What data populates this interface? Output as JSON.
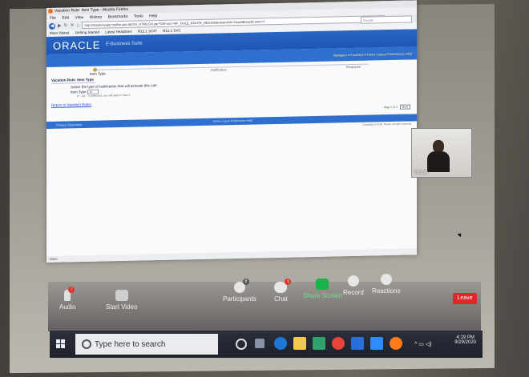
{
  "browser": {
    "title": "Vacation Rule: Item Type - Mozilla Firefox",
    "menu": [
      "File",
      "Edit",
      "View",
      "History",
      "Bookmarks",
      "Tools",
      "Help"
    ],
    "url": "http://ebsdemoapp.myfirst.gov.ab/OA_HTML/OA.jsp?OAFunc=WF_RULE_ROUTE_REGION&retainAM=Y&addBreadCrumb=Y",
    "search_placeholder": "Google",
    "bookmarks": [
      "Most Visited",
      "Getting Started",
      "Latest Headlines",
      "R12.1 SOIT",
      "R12.1 SVC"
    ],
    "status": "Done"
  },
  "app": {
    "logo": "ORACLE",
    "suite": "E-Business Suite",
    "header_links": "Navigator ▾   Favorites ▾   Home  Logout  Preferences  Help",
    "train_step": "Item Type",
    "train_notification": "Notification",
    "train_next": "Response",
    "page_title": "Vacation Rule: Item Type",
    "instruction": "Select the type of notification that will activate this rule.",
    "item_type_label": "Item Type",
    "item_type_value": "- All -",
    "hint": "If \"- All -\" is selected, you will skip to Step 2.",
    "return_link": "Return to Vacation Rules",
    "step_info": "Step 1 of 3",
    "next_button": "Next",
    "privacy": "Privacy Statement",
    "footer_links": "Home  Logout  Preferences  Help",
    "copyright": "Copyright (c) 2006, Oracle. All rights reserved."
  },
  "video": {
    "participant": "591590"
  },
  "zoom": {
    "audio": "Audio",
    "start_video": "Start Video",
    "participants": "Participants",
    "participants_count": "8",
    "chat": "Chat",
    "chat_badge": "1",
    "share": "Share Screen",
    "record": "Record",
    "reactions": "Reactions",
    "leave": "Leave",
    "audio_badge": "!"
  },
  "taskbar": {
    "search_placeholder": "Type here to search",
    "time": "4:19 PM",
    "date": "9/29/2020"
  },
  "colors": {
    "oracle_blue": "#2f6fd0",
    "share_green": "#18b54a",
    "leave_red": "#e0262b"
  }
}
